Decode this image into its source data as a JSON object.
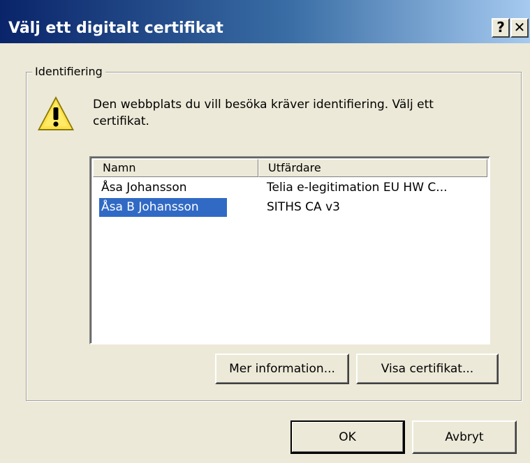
{
  "window": {
    "title": "Välj ett digitalt certifikat",
    "help_label": "?",
    "close_label": "✕"
  },
  "group": {
    "legend": "Identifiering",
    "prompt": "Den webbplats du vill besöka kräver identifiering. Välj ett certifikat."
  },
  "list": {
    "columns": [
      "Namn",
      "Utfärdare"
    ],
    "rows": [
      {
        "name": "Åsa Johansson",
        "issuer": "Telia e-legitimation EU HW C...",
        "selected": false
      },
      {
        "name": "Åsa B Johansson",
        "issuer": "SITHS CA v3",
        "selected": true
      }
    ]
  },
  "buttons": {
    "more_info": "Mer information...",
    "view_cert": "Visa certifikat...",
    "ok": "OK",
    "cancel": "Avbryt"
  },
  "colors": {
    "selection": "#316ac5",
    "dialog_bg": "#ece9d8",
    "title_start": "#0a246a",
    "title_end": "#a6caf0"
  },
  "icons": {
    "warning": "warning-icon"
  }
}
